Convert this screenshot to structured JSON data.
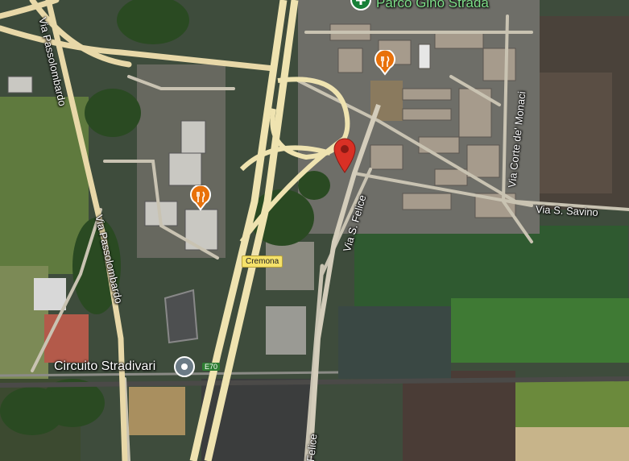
{
  "map": {
    "type": "satellite",
    "streets": {
      "passolombardo_top": "Via Passolombardo",
      "passolombardo_mid": "Via Passolombardo",
      "s_felice": "Via S. Felice",
      "s_felice_bottom": "Felice",
      "corte_de_monaci": "Via Corte de' Monaci",
      "s_savino": "Via S. Savino"
    },
    "places": {
      "park": "Parco Gino Strada",
      "circuit": "Circuito Stradivari"
    },
    "shields": {
      "cremona": "Cremona",
      "e70": "E70"
    },
    "icons": {
      "park": "park-plus-icon",
      "restaurant": "restaurant-icon",
      "pin": "map-pin-icon",
      "circuit": "place-marker-icon"
    },
    "colors": {
      "pin": "#d93025",
      "restaurant": "#e8710a",
      "park": "#188038",
      "shield_yellow": "#f5e26a"
    }
  }
}
